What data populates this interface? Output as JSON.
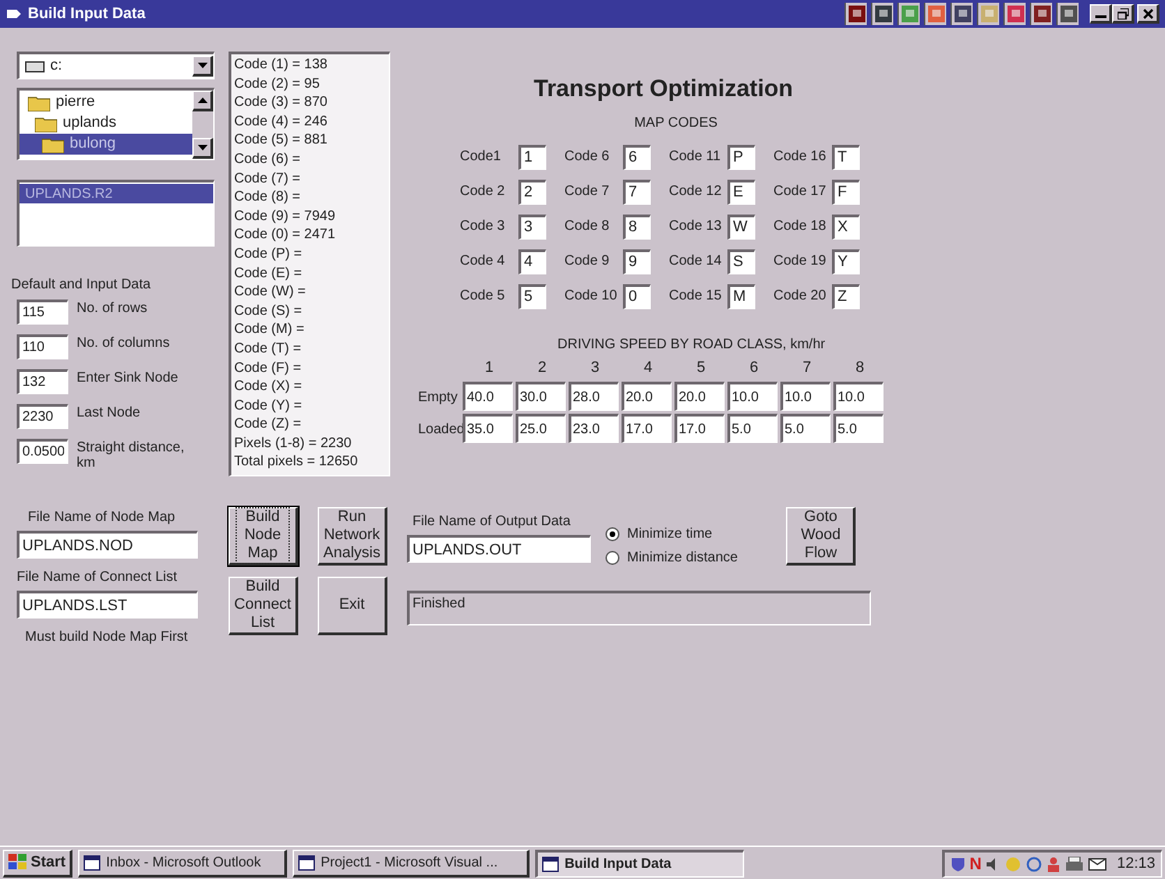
{
  "window": {
    "title": "Build Input Data"
  },
  "drive": {
    "value": "c:"
  },
  "folders": [
    {
      "name": "pierre",
      "selected": false
    },
    {
      "name": "uplands",
      "selected": false
    },
    {
      "name": "bulong",
      "selected": true
    }
  ],
  "files": [
    {
      "name": "UPLANDS.R2",
      "selected": true
    }
  ],
  "inputs": {
    "heading": "Default and Input Data",
    "fields": [
      {
        "value": "115",
        "label": "No. of rows"
      },
      {
        "value": "110",
        "label": "No. of columns"
      },
      {
        "value": "132",
        "label": "Enter Sink Node"
      },
      {
        "value": "2230",
        "label": "Last Node"
      },
      {
        "value": "0.0500",
        "label": "Straight distance, km"
      }
    ]
  },
  "code_list": [
    "Code (1) = 138",
    "Code (2) = 95",
    "Code (3) = 870",
    "Code (4) = 246",
    "Code (5) = 881",
    "Code (6) =",
    "Code (7) =",
    "Code (8) =",
    "Code (9) = 7949",
    "Code (0) = 2471",
    "Code (P) =",
    "Code (E) =",
    "Code (W) =",
    "Code (S) =",
    "Code (M) =",
    "Code (T) =",
    "Code (F) =",
    "Code (X) =",
    "Code (Y) =",
    "Code (Z) =",
    "Pixels (1-8) = 2230",
    "Total pixels = 12650"
  ],
  "title": "Transport Optimization",
  "map_codes": {
    "heading": "MAP CODES",
    "codes": [
      {
        "label": "Code1",
        "value": "1"
      },
      {
        "label": "Code 2",
        "value": "2"
      },
      {
        "label": "Code 3",
        "value": "3"
      },
      {
        "label": "Code 4",
        "value": "4"
      },
      {
        "label": "Code 5",
        "value": "5"
      },
      {
        "label": "Code 6",
        "value": "6"
      },
      {
        "label": "Code 7",
        "value": "7"
      },
      {
        "label": "Code 8",
        "value": "8"
      },
      {
        "label": "Code 9",
        "value": "9"
      },
      {
        "label": "Code 10",
        "value": "0"
      },
      {
        "label": "Code 11",
        "value": "P"
      },
      {
        "label": "Code 12",
        "value": "E"
      },
      {
        "label": "Code 13",
        "value": "W"
      },
      {
        "label": "Code 14",
        "value": "S"
      },
      {
        "label": "Code 15",
        "value": "M"
      },
      {
        "label": "Code 16",
        "value": "T"
      },
      {
        "label": "Code 17",
        "value": "F"
      },
      {
        "label": "Code 18",
        "value": "X"
      },
      {
        "label": "Code 19",
        "value": "Y"
      },
      {
        "label": "Code 20",
        "value": "Z"
      }
    ]
  },
  "driving_speed": {
    "heading": "DRIVING SPEED BY ROAD CLASS, km/hr",
    "columns": [
      "1",
      "2",
      "3",
      "4",
      "5",
      "6",
      "7",
      "8"
    ],
    "rows": [
      {
        "label": "Empty",
        "values": [
          "40.0",
          "30.0",
          "28.0",
          "20.0",
          "20.0",
          "10.0",
          "10.0",
          "10.0"
        ]
      },
      {
        "label": "Loaded",
        "values": [
          "35.0",
          "25.0",
          "23.0",
          "17.0",
          "17.0",
          "5.0",
          "5.0",
          "5.0"
        ]
      }
    ]
  },
  "node_map": {
    "label": "File Name of Node Map",
    "value": "UPLANDS.NOD"
  },
  "connect_list": {
    "label": "File Name of Connect List",
    "value": "UPLANDS.LST"
  },
  "note": "Must build Node Map First",
  "buttons": [
    {
      "label": "Build Node Map",
      "focused": true
    },
    {
      "label": "Run Network Analysis",
      "focused": false
    },
    {
      "label": "Build Connect List",
      "focused": false
    },
    {
      "label": "Exit",
      "focused": false
    }
  ],
  "output": {
    "label": "File Name of Output Data",
    "value": "UPLANDS.OUT"
  },
  "objective": [
    {
      "label": "Minimize time",
      "selected": true
    },
    {
      "label": "Minimize distance",
      "selected": false
    }
  ],
  "goto_button": "Goto Wood Flow",
  "status": "Finished",
  "taskbar": {
    "start": "Start",
    "tasks": [
      {
        "label": "Inbox - Microsoft Outlook",
        "selected": false
      },
      {
        "label": "Project1 - Microsoft Visual ...",
        "selected": false
      },
      {
        "label": "Build Input Data",
        "selected": true
      }
    ],
    "tray_letter": "N",
    "clock": "12:13"
  }
}
